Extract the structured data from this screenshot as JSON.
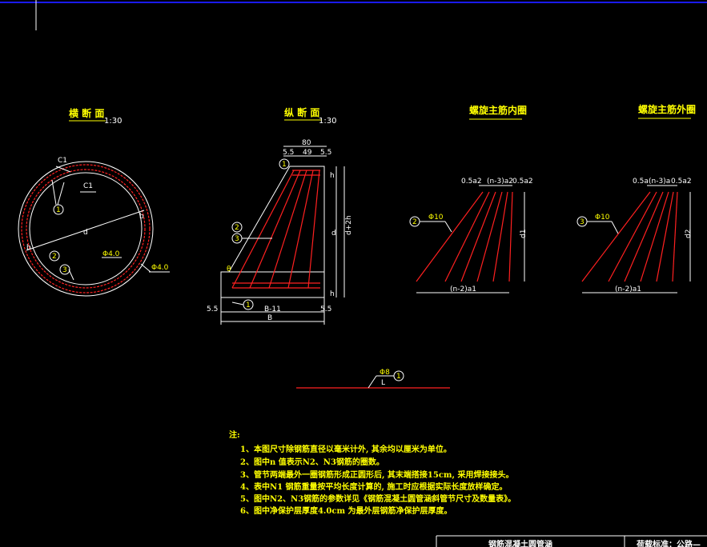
{
  "views": {
    "cross_section": {
      "title": "横 断 面",
      "scale": "1:30"
    },
    "longitudinal": {
      "title": "纵 断 面",
      "scale": "1:30"
    },
    "inner_spiral": {
      "title": "螺旋主筋内圈"
    },
    "outer_spiral": {
      "title": "螺旋主筋外圈"
    }
  },
  "cross_dims": {
    "c1": "C1",
    "c1b": "C1",
    "d": "d",
    "b": "b",
    "phi_inner": "Φ4.0",
    "phi_outer": "Φ4.0"
  },
  "long_dims": {
    "top_total": "80",
    "top_left": "5.5",
    "top_mid": "49",
    "top_right": "5.5",
    "h_top": "h",
    "d": "d",
    "d_plus": "d+2h",
    "h_bot": "h",
    "angle": "θ",
    "bottom_inner": "B-11",
    "bottom_total": "B",
    "bot_left": "5.5",
    "bot_right": "5.5"
  },
  "inner_dims": {
    "top_left": "0.5a2",
    "top_mid": "(n-3)a2",
    "top_right": "0.5a2",
    "phi": "Φ10",
    "bottom": "(n-2)a1",
    "height": "d1"
  },
  "outer_dims": {
    "top_left": "0.5a",
    "top_mid": "(n-3)a",
    "top_right": "0.5a2",
    "phi": "Φ10",
    "bottom": "(n-2)a1",
    "height": "d2"
  },
  "stirrup": {
    "phi": "Φ8",
    "length": "L"
  },
  "markers": {
    "m1": "1",
    "m2": "2",
    "m3": "3"
  },
  "notes": {
    "heading": "注:",
    "items": [
      "1、本图尺寸除钢筋直径以毫米计外, 其余均以厘米为单位。",
      "2、图中n 值表示N2、N3钢筋的圈数。",
      "3、管节两端最外一圈钢筋形成正圆形后, 其末端搭接15cm, 采用焊接接头。",
      "4、表中N1 钢筋重量按平均长度计算的, 施工时应根据实际长度放样确定。",
      "5、图中N2、N3钢筋的参数详见《钢筋混凝土圆管涵斜管节尺寸及数量表》。",
      "6、图中净保护层厚度4.0cm 为最外层钢筋净保护层厚度。"
    ]
  },
  "title_block": {
    "drawing_name": "钢筋混凝土圆管涵",
    "standard": "荷载标准：公路—"
  },
  "colors": {
    "accent_blue": "#1a1aff",
    "rebar": "#ff2020",
    "text": "#ffff00"
  }
}
